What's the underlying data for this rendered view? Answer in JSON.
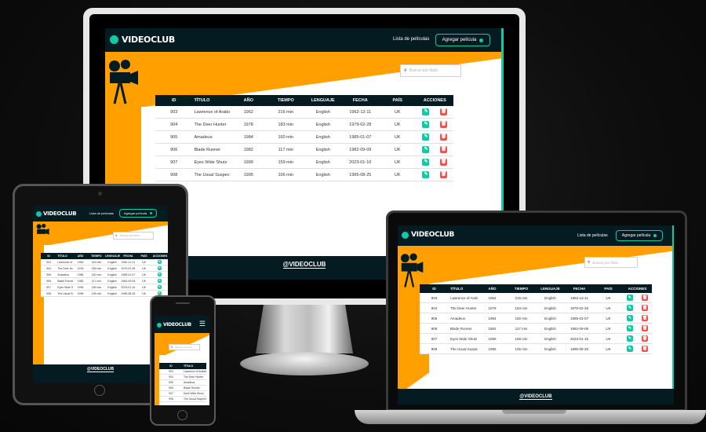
{
  "app": {
    "brand": "VIDEOCLUB",
    "footer_brand": "@VIDEOCLUB"
  },
  "nav": {
    "list_link": "Lista de películas",
    "add_button": "Agregar película"
  },
  "search": {
    "placeholder": "Buscar por título"
  },
  "table": {
    "headers": [
      "ID",
      "TÍTULO",
      "AÑO",
      "TIEMPO",
      "LENGUAJE",
      "FECHA",
      "PAÍS",
      "ACCIONES"
    ],
    "rows": [
      {
        "id": "903",
        "title": "Lawrence of Arabia",
        "year": "1962",
        "time": "216 min",
        "lang": "English",
        "date": "1962-12-11",
        "country": "UK"
      },
      {
        "id": "904",
        "title": "The Deer Hunter",
        "year": "1978",
        "time": "183 min",
        "lang": "English",
        "date": "1979-02-28",
        "country": "UK"
      },
      {
        "id": "905",
        "title": "Amadeus",
        "year": "1984",
        "time": "160 min",
        "lang": "English",
        "date": "1985-01-07",
        "country": "UK"
      },
      {
        "id": "906",
        "title": "Blade Runner",
        "year": "1982",
        "time": "117 min",
        "lang": "English",
        "date": "1982-09-09",
        "country": "UK"
      },
      {
        "id": "907",
        "title": "Eyes Wide Shutz",
        "year": "1999",
        "time": "159 min",
        "lang": "English",
        "date": "2023-01-16",
        "country": "UK"
      },
      {
        "id": "908",
        "title": "The Usual Suspects",
        "year": "1995",
        "time": "106 min",
        "lang": "English",
        "date": "1995-08-25",
        "country": "UK"
      }
    ]
  },
  "colors": {
    "navy": "#041b22",
    "teal": "#10c9a7",
    "orange": "#ffa000",
    "red": "#ef5350"
  },
  "icons": {
    "edit": "pencil-icon",
    "delete": "trash-icon",
    "search": "search-icon",
    "menu": "hamburger-icon"
  }
}
